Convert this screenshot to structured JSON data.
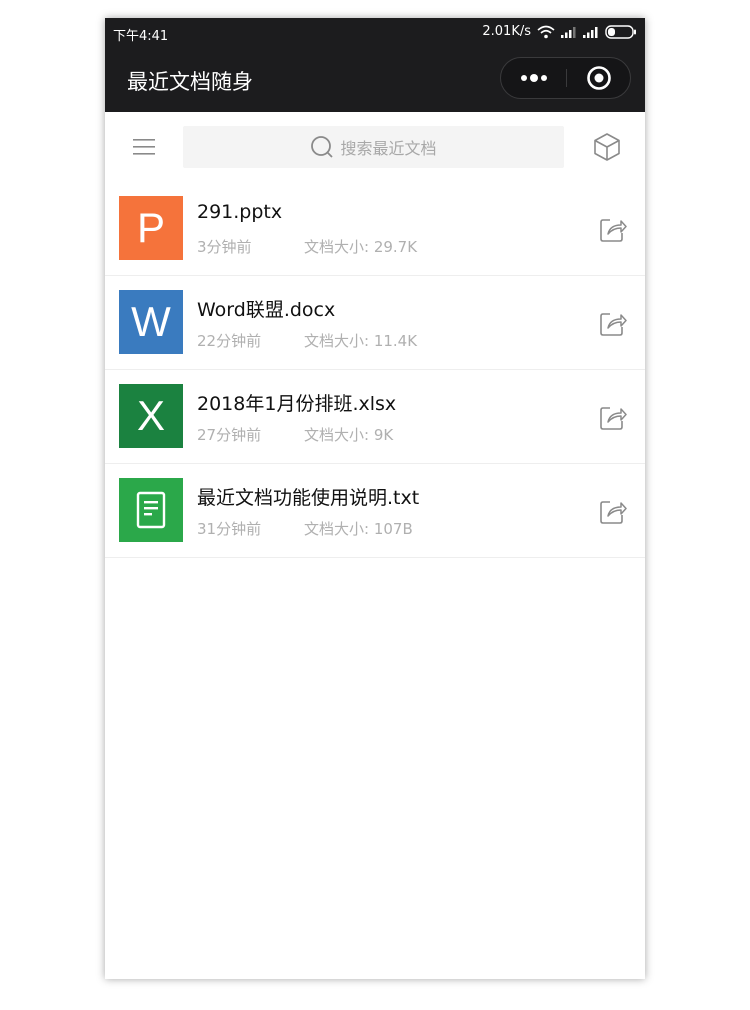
{
  "status_bar": {
    "time": "下午4:41",
    "network_speed": "2.01K/s",
    "icons": [
      "wifi-icon",
      "signal-icon",
      "signal-icon",
      "battery-icon"
    ]
  },
  "nav": {
    "title": "最近文档随身",
    "capsule_icons": [
      "more-icon",
      "close-target-icon"
    ]
  },
  "search": {
    "placeholder": "搜索最近文档",
    "icons": [
      "menu-icon",
      "search-icon",
      "cube-icon"
    ]
  },
  "documents": [
    {
      "type_letter": "P",
      "icon": "powerpoint-icon",
      "icon_color": "#F5733B",
      "name": "291.pptx",
      "time": "3分钟前",
      "size_label": "文档大小: 29.7K"
    },
    {
      "type_letter": "W",
      "icon": "word-icon",
      "icon_color": "#3A7BBF",
      "name": "Word联盟.docx",
      "time": "22分钟前",
      "size_label": "文档大小: 11.4K"
    },
    {
      "type_letter": "X",
      "icon": "excel-icon",
      "icon_color": "#1B8240",
      "name": "2018年1月份排班.xlsx",
      "time": "27分钟前",
      "size_label": "文档大小: 9K"
    },
    {
      "type_letter": "",
      "icon": "text-file-icon",
      "icon_color": "#2BA84A",
      "name": "最近文档功能使用说明.txt",
      "time": "31分钟前",
      "size_label": "文档大小: 107B"
    }
  ],
  "colors": {
    "bar_background": "#1C1C1E",
    "search_background": "#F4F4F4",
    "meta_text": "#B0B0B0"
  }
}
